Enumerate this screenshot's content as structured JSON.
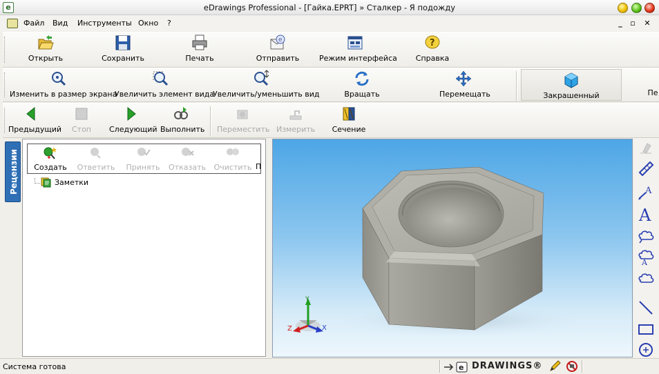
{
  "window": {
    "title": "eDrawings Professional - [Гайка.EPRT]  » Сталкер - Я подожду"
  },
  "menu": {
    "items": [
      "Файл",
      "Вид",
      "Инструменты",
      "Окно",
      "?"
    ]
  },
  "toolbar1": {
    "open": "Открыть",
    "save": "Сохранить",
    "print": "Печать",
    "send": "Отправить",
    "ui_mode": "Режим интерфейса",
    "help": "Справка"
  },
  "toolbar2": {
    "zoom_fit": "Изменить в размер экрана",
    "zoom_area": "Увеличить элемент вида",
    "zoom_in_out": "Увеличить/уменьшить вид",
    "rotate": "Вращать",
    "pan": "Перемещать",
    "shaded": "Закрашенный",
    "cut_label": "Пе"
  },
  "toolbar3": {
    "prev": "Предыдущий",
    "stop": "Стоп",
    "next": "Следующий",
    "play": "Выполнить",
    "move": "Переместить",
    "measure": "Измерить",
    "section": "Сечение"
  },
  "reviews": {
    "tab_label": "Рецензии",
    "create": "Создать",
    "reply": "Ответить",
    "accept": "Принять",
    "reject": "Отказать",
    "clear": "Очистить",
    "cut_label": "П",
    "tree_root": "Заметки"
  },
  "triad": {
    "x": "X",
    "y": "Y",
    "z": "Z"
  },
  "status": {
    "text": "Система готова",
    "brand": "DRAWINGS®"
  },
  "colors": {
    "accent": "#2f6fb5",
    "viewport_top": "#4da6e6",
    "viewport_bottom": "#eef7fc",
    "nut_face": "#a5a49c"
  },
  "icons": [
    "open-folder-icon",
    "save-disk-icon",
    "printer-icon",
    "send-mail-icon",
    "interface-mode-icon",
    "help-icon",
    "zoom-fit-icon",
    "zoom-area-icon",
    "zoom-in-out-icon",
    "rotate-icon",
    "pan-icon",
    "shaded-cube-icon",
    "prev-icon",
    "stop-icon",
    "next-icon",
    "play-icon",
    "move-component-icon",
    "measure-icon",
    "section-icon",
    "create-markup-icon",
    "reply-icon",
    "accept-icon",
    "reject-icon",
    "clear-icon",
    "notes-icon",
    "stamp-icon",
    "dimension-icon",
    "leader-text-icon",
    "text-icon",
    "cloud-icon",
    "cloud-text-icon",
    "cloud-bubble-icon",
    "line-icon",
    "rectangle-icon",
    "circle-icon",
    "pencil-icon",
    "no-markup-icon"
  ]
}
